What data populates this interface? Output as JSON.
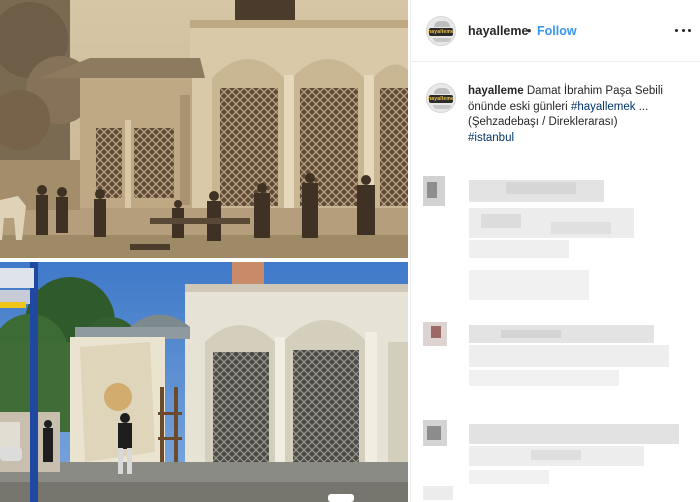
{
  "post": {
    "username": "hayalleme",
    "separator": "•",
    "follow_label": "Follow",
    "more_icon": "more-horizontal-icon"
  },
  "caption": {
    "username": "hayalleme",
    "text_part1": "Damat İbrahim Paşa Sebili önünde eski günleri",
    "hashtag1": "#hayallemek",
    "ellipsis": "...",
    "text_part2": "(Şehzadebaşı / Direklerarası)",
    "hashtag2": "#istanbul"
  },
  "avatar": {
    "logo_text": "hayalleme"
  },
  "images": {
    "top": "sepia-historic-sebil-photo",
    "bottom": "modern-color-sebil-photo"
  },
  "colors": {
    "link_blue": "#3897f0",
    "hashtag_blue": "#003569",
    "text": "#262626",
    "border": "#efefef"
  }
}
